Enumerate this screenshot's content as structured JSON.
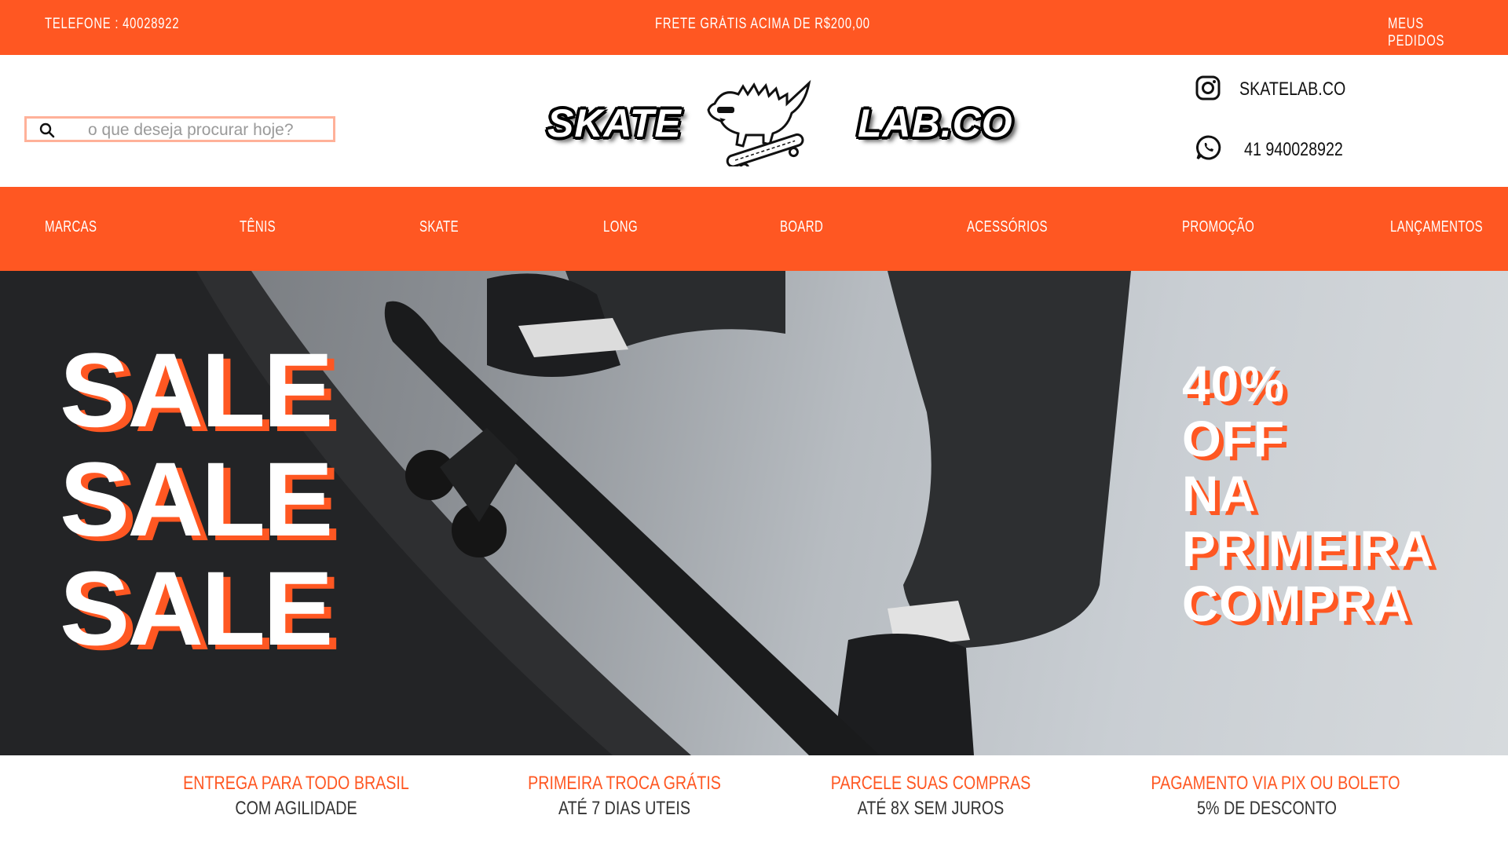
{
  "topbar": {
    "phone": "TELEFONE : 40028922",
    "shipping": "FRETE GRÁTIS ACIMA DE R$200,00",
    "orders": "MEUS PEDIDOS"
  },
  "search": {
    "placeholder": "o que deseja procurar hoje?"
  },
  "logo": {
    "left_word": "SKATE",
    "right_word": "LAB.CO"
  },
  "social": {
    "instagram": "SKATELAB.CO",
    "whatsapp": "41 940028922"
  },
  "nav": {
    "items": [
      "MARCAS",
      "TÊNIS",
      "SKATE",
      "LONG",
      "BOARD",
      "ACESSÓRIOS",
      "PROMOÇÃO",
      "LANÇAMENTOS"
    ]
  },
  "hero": {
    "sale_lines": [
      "SALE",
      "SALE",
      "SALE"
    ],
    "offer_lines": [
      "40%",
      "OFF",
      "NA",
      "PRIMEIRA",
      "COMPRA"
    ]
  },
  "benefits": [
    {
      "title": "ENTREGA PARA TODO BRASIL",
      "subtitle": "COM AGILIDADE"
    },
    {
      "title": "PRIMEIRA TROCA GRÁTIS",
      "subtitle": "ATÉ 7 DIAS UTEIS"
    },
    {
      "title": "PARCELE SUAS COMPRAS",
      "subtitle": "ATÉ 8X SEM JUROS"
    },
    {
      "title": "PAGAMENTO VIA PIX OU BOLETO",
      "subtitle": "5% DE DESCONTO"
    }
  ],
  "colors": {
    "accent": "#ff5722",
    "text_dark": "#333333"
  }
}
